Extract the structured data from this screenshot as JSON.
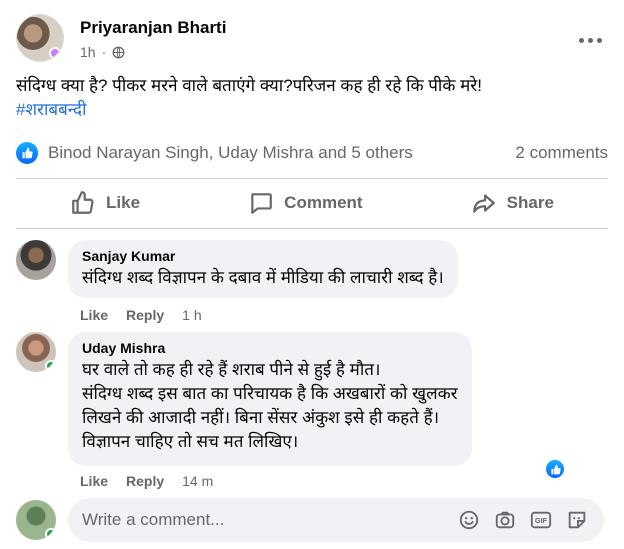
{
  "post": {
    "author": "Priyaranjan Bharti",
    "time": "1h",
    "separator": "·",
    "text": "संदिग्ध क्या है? पीकर मरने वाले बताएंगे क्या?परिजन कह ही रहे कि पीके मरे!",
    "hashtag": "#शराबबन्दी"
  },
  "reactions": {
    "names": "Binod Narayan Singh, Uday Mishra and 5 others",
    "comments_count": "2 comments"
  },
  "actions": {
    "like": "Like",
    "comment": "Comment",
    "share": "Share"
  },
  "comments": [
    {
      "name": "Sanjay Kumar",
      "lines": [
        "संदिग्ध शब्द विज्ञापन के दबाव में मीडिया की लाचारी शब्द है।"
      ],
      "like": "Like",
      "reply": "Reply",
      "time": "1 h"
    },
    {
      "name": "Uday Mishra",
      "lines": [
        "घर वाले तो कह ही रहे हैं शराब पीने से हुई है मौत।",
        "संदिग्ध शब्द इस बात का परिचायक है कि अखबारों को खुलकर",
        "लिखने की आजादी नहीं। बिना सेंसर अंकुश इसे ही कहते हैं।",
        "विज्ञापन चाहिए तो सच मत लिखिए।"
      ],
      "like": "Like",
      "reply": "Reply",
      "time": "14 m"
    }
  ],
  "composer": {
    "placeholder": "Write a comment..."
  },
  "colors": {
    "accent": "#0866ff",
    "hashtag": "#216fdb",
    "secondary_text": "#65676b",
    "bubble_bg": "#f0f2f5",
    "online": "#31a24c"
  },
  "icons": {
    "more": "more-horizontal-icon",
    "globe": "globe-icon",
    "like_reaction": "like-reaction-icon",
    "like": "thumbs-up-icon",
    "comment": "speech-bubble-icon",
    "share": "share-arrow-icon",
    "emoji": "emoji-icon",
    "camera": "camera-icon",
    "gif": "gif-icon",
    "sticker": "sticker-icon"
  }
}
